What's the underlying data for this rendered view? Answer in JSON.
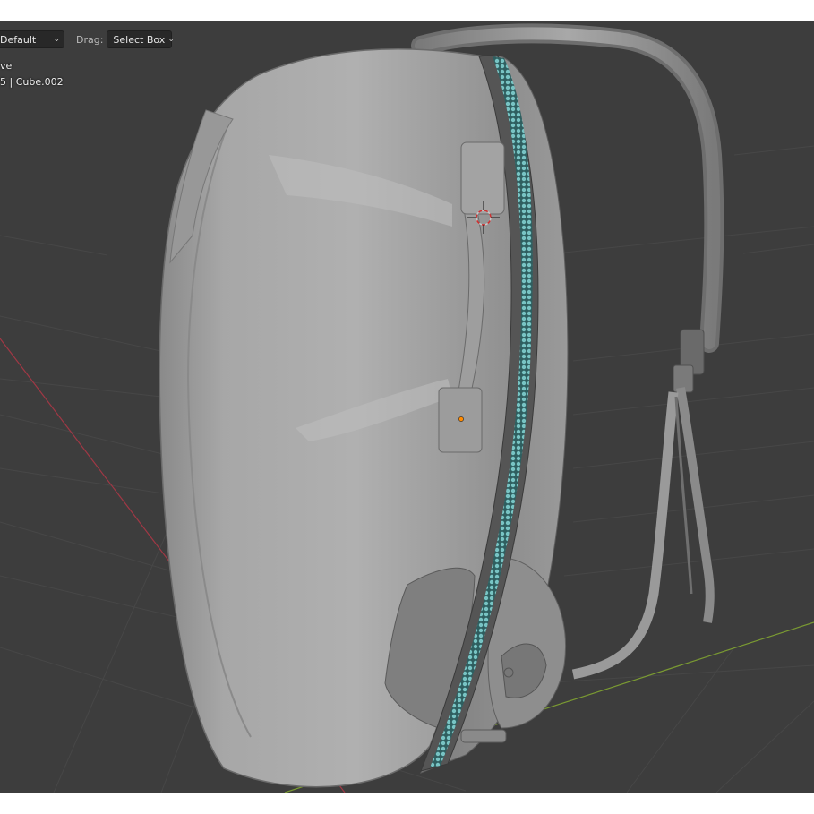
{
  "header": {
    "orientation_value": "Default",
    "drag_label": "Drag:",
    "drag_value": "Select Box"
  },
  "overlay": {
    "mode_text": "ve",
    "object_text": "5 | Cube.002"
  },
  "icons": {
    "orientation_chevron": "chevron-down-icon",
    "drag_chevron": "chevron-down-icon",
    "cursor": "3d-cursor-icon",
    "origin": "object-origin-icon"
  },
  "colors": {
    "viewport_bg": "#3d3d3d",
    "grid_line": "#4a4a4a",
    "x_axis": "#a03845",
    "y_axis": "#7a9a32",
    "model_grey": "#a9a9a9",
    "zipper_teal": "#5fa8a8",
    "origin": "#ff8a00"
  }
}
